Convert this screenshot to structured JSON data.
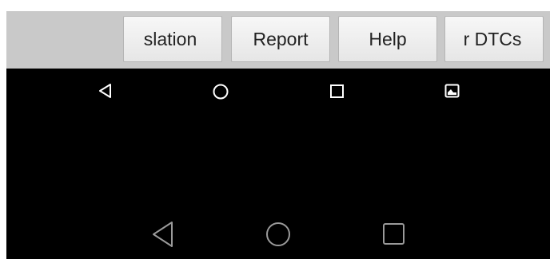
{
  "toolbar": {
    "buttons": [
      {
        "label": "slation"
      },
      {
        "label": "Report"
      },
      {
        "label": "Help"
      },
      {
        "label": "r DTCs"
      }
    ]
  },
  "top_nav": {
    "icons": [
      "back-icon",
      "home-icon",
      "recents-icon",
      "screenshot-icon"
    ]
  },
  "bottom_nav": {
    "icons": [
      "back-icon",
      "home-icon",
      "recents-icon"
    ]
  },
  "colors": {
    "toolbar_bg": "#c9c9c9",
    "screen_bg": "#000000",
    "nav_icon_top": "#ffffff",
    "nav_icon_bottom": "#9a9a9a"
  }
}
